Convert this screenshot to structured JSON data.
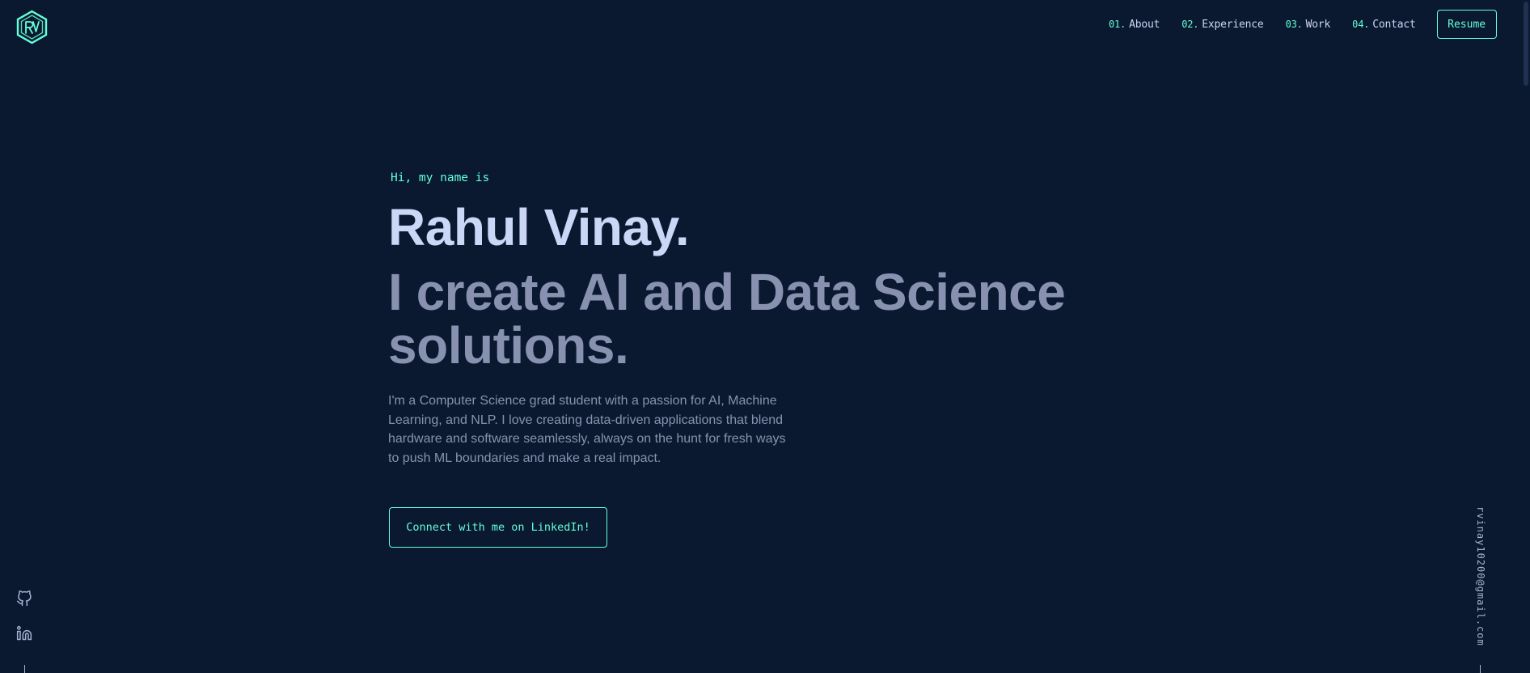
{
  "header": {
    "logo_label": "RV",
    "nav": [
      {
        "num": "01.",
        "label": "About"
      },
      {
        "num": "02.",
        "label": "Experience"
      },
      {
        "num": "03.",
        "label": "Work"
      },
      {
        "num": "04.",
        "label": "Contact"
      }
    ],
    "resume_label": "Resume"
  },
  "hero": {
    "greeting": "Hi, my name is",
    "name": "Rahul Vinay.",
    "tagline": "I create AI and Data Science solutions.",
    "bio": "I'm a Computer Science grad student with a passion for AI, Machine Learning, and NLP. I love creating data-driven applications that blend hardware and software seamlessly, always on the hunt for fresh ways to push ML boundaries and make a real impact.",
    "cta_label": "Connect with me on LinkedIn!"
  },
  "social": {
    "icons": [
      "github-icon",
      "linkedin-icon"
    ]
  },
  "email": "rvinay10200@gmail.com",
  "colors": {
    "background": "#0a192f",
    "accent": "#64ffda",
    "heading": "#ccd6f6",
    "body": "#8892b0"
  }
}
